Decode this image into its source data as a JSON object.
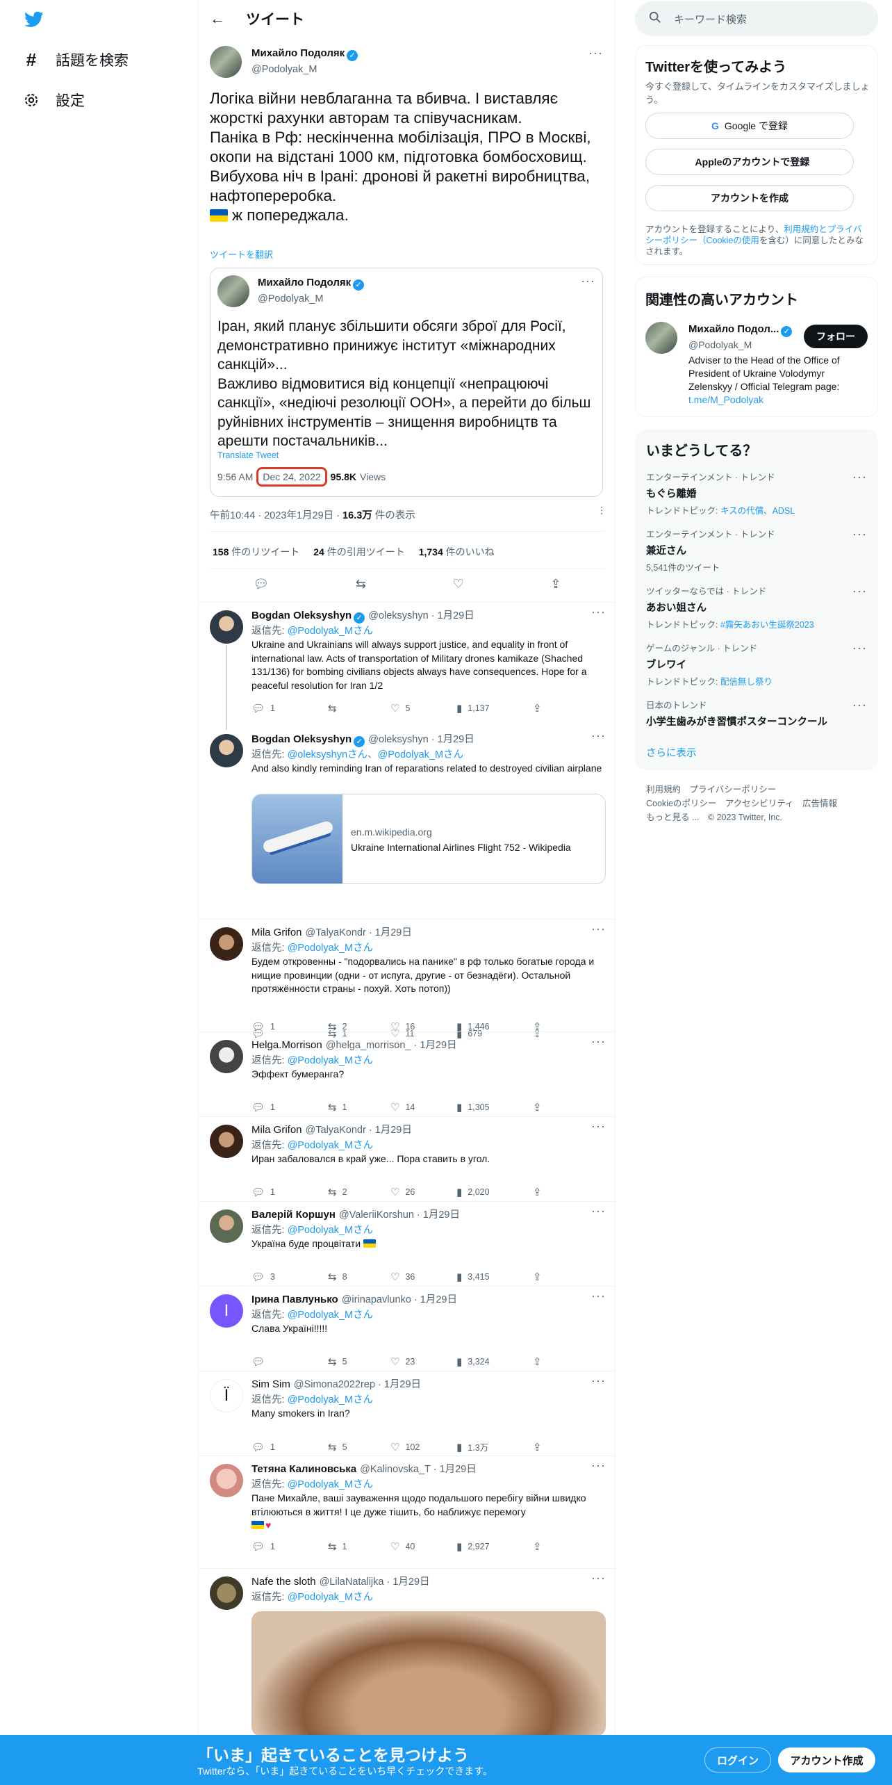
{
  "nav": {
    "explore_label": "話題を検索",
    "settings_label": "設定"
  },
  "header": {
    "title": "ツイート"
  },
  "tweet": {
    "author_name": "Михайло Подоляк",
    "author_handle": "@Podolyak_M",
    "text": "Логіка війни невблаганна та вбивча. І виставляє жорсткі рахунки авторам та співучасникам.\nПаніка в Рф: нескінченна мобілізація, ПРО в Москві, окопи на відстані 1000 км, підготовка бомбосховищ.\nВибухова ніч в Ірані: дронові й ракетні виробництва, нафтопереробка.",
    "last_line": "ж попереджала.",
    "translate_label": "ツイートを翻訳",
    "time": "午前10:44",
    "date": "2023年1月29日",
    "views_count": "16.3万",
    "views_label": "件の表示",
    "retweets": "158",
    "retweets_label": "件のリツイート",
    "quotes": "24",
    "quotes_label": "件の引用ツイート",
    "likes": "1,734",
    "likes_label": "件のいいね"
  },
  "quote": {
    "author_name": "Михайло Подоляк",
    "author_handle": "@Podolyak_M",
    "text": "Іран, який планує збільшити обсяги зброї для Росії, демонстративно принижує інститут «міжнародних санкцій»...\nВажливо відмовитися від концепції «непрацюючі санкції», «недіючі резолюції ООН», а перейти до більш руйнівних інструментів – знищення виробництв та арешти постачальників...",
    "translate_label": "Translate Tweet",
    "time": "9:56 AM",
    "date": "Dec 24, 2022",
    "views_count": "95.8K",
    "views_label": "Views"
  },
  "reply_prefix": "返信先: ",
  "replies": [
    {
      "name": "Bogdan Oleksyshyn",
      "handle": "@oleksyshyn · 1月29日",
      "reply_to": "@Podolyak_Mさん",
      "text": "Ukraine and Ukrainians will always support justice, and equality in front of international law. Acts of transportation of Military drones kamikaze (Shached 131/136) for bombing civilians objects always have consequences. Hope for a peaceful resolution for Iran 1/2",
      "replies": "1",
      "retweets": "",
      "likes": "5",
      "views": "1,137"
    },
    {
      "name": "Bogdan Oleksyshyn",
      "handle": "@oleksyshyn · 1月29日",
      "reply_to": "@oleksyshynさん、@Podolyak_Mさん",
      "text": "And also kindly reminding Iran of reparations related to destroyed civilian airplane",
      "card_domain": "en.m.wikipedia.org",
      "card_title": "Ukraine International Airlines Flight 752 - Wikipedia",
      "replies": "",
      "retweets": "1",
      "likes": "11",
      "views": "679"
    },
    {
      "name": "Mila Grifon",
      "handle": "@TalyaKondr · 1月29日",
      "reply_to": "@Podolyak_Mさん",
      "text": "Будем откровенны - \"подорвались на панике\" в рф только богатые города и нищие провинции (одни - от испуга, другие - от безнадёги). Остальной протяжённости страны - похуй. Хоть потоп))",
      "replies": "1",
      "retweets": "2",
      "likes": "16",
      "views": "1,446"
    },
    {
      "name": "Helga.Morrison",
      "handle": "@helga_morrison_ · 1月29日",
      "reply_to": "@Podolyak_Mさん",
      "text": "Эффект бумеранга?",
      "replies": "1",
      "retweets": "1",
      "likes": "14",
      "views": "1,305"
    },
    {
      "name": "Mila Grifon",
      "handle": "@TalyaKondr · 1月29日",
      "reply_to": "@Podolyak_Mさん",
      "text": "Иран забаловался в край уже... Пора ставить в угол.",
      "replies": "1",
      "retweets": "2",
      "likes": "26",
      "views": "2,020"
    },
    {
      "name": "Валерій Коршун",
      "handle": "@ValeriiKorshun · 1月29日",
      "reply_to": "@Podolyak_Mさん",
      "text": "Україна буде процвітати",
      "replies": "3",
      "retweets": "8",
      "likes": "36",
      "views": "3,415"
    },
    {
      "name": "Ірина Павлунько",
      "handle": "@irinapavlunko · 1月29日",
      "reply_to": "@Podolyak_Mさん",
      "text": "Слава Україні!!!!!",
      "avatar_letter": "I",
      "replies": "",
      "retweets": "5",
      "likes": "23",
      "views": "3,324"
    },
    {
      "name": "Sim Sim",
      "handle": "@Simona2022rep · 1月29日",
      "reply_to": "@Podolyak_Mさん",
      "text": "Many smokers in Iran?",
      "avatar_letter": "Ï",
      "replies": "1",
      "retweets": "5",
      "likes": "102",
      "views": "1.3万"
    },
    {
      "name": "Тетяна Калиновська",
      "handle": "@Kalinovska_T · 1月29日",
      "reply_to": "@Podolyak_Mさん",
      "text": "Пане Михайле, ваші зауваження щодо подальшого перебігу війни швидко втілюються в життя! І це дуже тішить, бо наближує перемогу",
      "replies": "1",
      "retweets": "1",
      "likes": "40",
      "views": "2,927"
    },
    {
      "name": "Nafe the sloth",
      "handle": "@LilaNatalijka · 1月29日",
      "reply_to": "@Podolyak_Mさん"
    }
  ],
  "sidebar": {
    "search_placeholder": "キーワード検索",
    "signup": {
      "title": "Twitterを使ってみよう",
      "subtitle": "今すぐ登録して、タイムラインをカスタマイズしましょう。",
      "google": "Google で登録",
      "apple": "Appleのアカウントで登録",
      "create": "アカウントを作成",
      "legal_pre": "アカウントを登録することにより、",
      "legal_links": "利用規約とプライバシーポリシー（Cookieの使用",
      "legal_post": "を含む）に同意したとみなされます。"
    },
    "related": {
      "title": "関連性の高いアカウント",
      "name": "Михайло Подол...",
      "handle": "@Podolyak_M",
      "follow": "フォロー",
      "bio": "Adviser to the Head of the Office of President of Ukraine Volodymyr Zelenskyy / Official Telegram page:",
      "link": "t.me/M_Podolyak"
    },
    "trends": {
      "title": "いまどうしてる？",
      "items": [
        {
          "category": "エンターテインメント · トレンド",
          "title": "もぐら離婚",
          "sub_label": "トレンドトピック: ",
          "sub_link": "キスの代償、ADSL"
        },
        {
          "category": "エンターテインメント · トレンド",
          "title": "兼近さん",
          "sub_label": "5,541件のツイート",
          "sub_link": ""
        },
        {
          "category": "ツイッターならでは · トレンド",
          "title": "あおい姐さん",
          "sub_label": "トレンドトピック: ",
          "sub_link": "#霧矢あおい生誕祭2023"
        },
        {
          "category": "ゲームのジャンル · トレンド",
          "title": "ブレワイ",
          "sub_label": "トレンドトピック: ",
          "sub_link": "配信無し祭り"
        },
        {
          "category": "日本のトレンド",
          "title": "小学生歯みがき習慣ポスターコンクール",
          "sub_label": "",
          "sub_link": ""
        }
      ],
      "show_more": "さらに表示"
    },
    "footer": {
      "line1": "利用規約　プライバシーポリシー",
      "line2": "Cookieのポリシー　アクセシビリティ　広告情報",
      "line3": "もっと見る ...　© 2023 Twitter, Inc."
    }
  },
  "bottom_bar": {
    "headline": "「いま」起きていることを見つけよう",
    "sub": "Twitterなら、「いま」起きていることをいち早くチェックできます。",
    "login": "ログイン",
    "signup": "アカウント作成"
  }
}
